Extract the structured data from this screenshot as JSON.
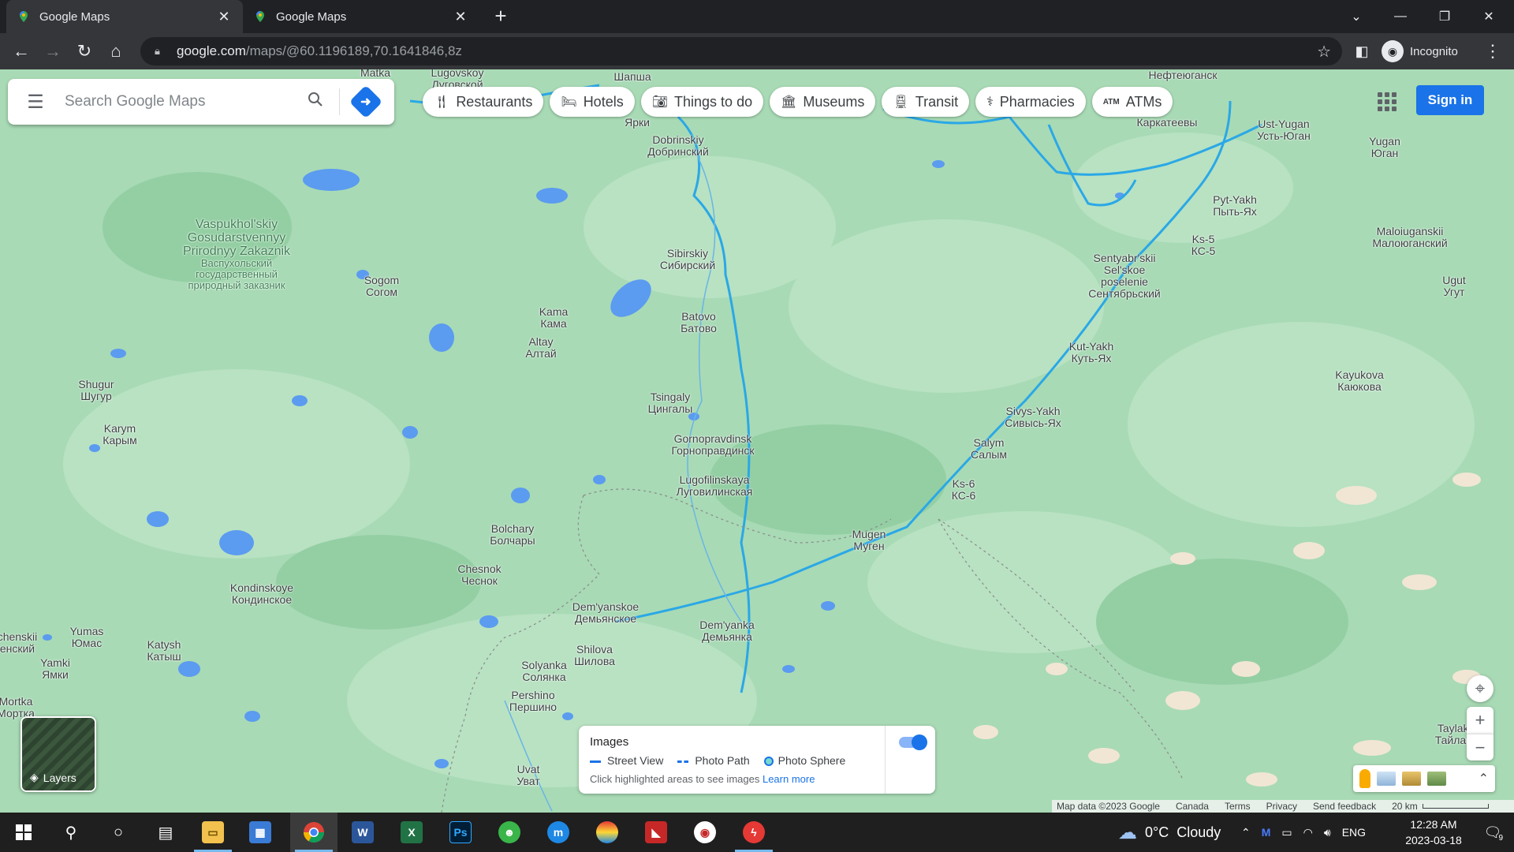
{
  "browser": {
    "tabs": [
      {
        "title": "Google Maps"
      },
      {
        "title": "Google Maps"
      }
    ],
    "url_host": "google.com",
    "url_path": "/maps/@60.1196189,70.1641846,8z",
    "profile_label": "Incognito"
  },
  "maps": {
    "search_placeholder": "Search Google Maps",
    "chips": [
      {
        "label": "Restaurants",
        "icon": "fork-knife-icon"
      },
      {
        "label": "Hotels",
        "icon": "bed-icon"
      },
      {
        "label": "Things to do",
        "icon": "camera-icon"
      },
      {
        "label": "Museums",
        "icon": "museum-icon"
      },
      {
        "label": "Transit",
        "icon": "train-icon"
      },
      {
        "label": "Pharmacies",
        "icon": "pharmacy-icon"
      },
      {
        "label": "ATMs",
        "icon": "atm-icon"
      }
    ],
    "sign_in": "Sign in",
    "layers_label": "Layers",
    "images_panel": {
      "title": "Images",
      "street_view": "Street View",
      "photo_path": "Photo Path",
      "photo_sphere": "Photo Sphere",
      "hint": "Click highlighted areas to see images",
      "learn_more": "Learn more",
      "toggle_on": true
    },
    "attribution": {
      "map_data": "Map data ©2023 Google",
      "country": "Canada",
      "terms": "Terms",
      "privacy": "Privacy",
      "feedback": "Send feedback",
      "scale": "20 km"
    },
    "places": [
      {
        "en": "Matka",
        "ru": ""
      },
      {
        "en": "Lugovskoy",
        "ru": "Луговской"
      },
      {
        "en": "",
        "ru": "Шапша"
      },
      {
        "en": "",
        "ru": "Ярки"
      },
      {
        "en": "Dobrinskiy",
        "ru": "Добринский"
      },
      {
        "en": "Vaspukhol'skiy Gosudarstvennyy Prirodnyy Zakaznik",
        "ru": "Васпухольский государственный природный заказник"
      },
      {
        "en": "Sogom",
        "ru": "Согом"
      },
      {
        "en": "Sibirskiy",
        "ru": "Сибирский"
      },
      {
        "en": "Kama",
        "ru": "Кама"
      },
      {
        "en": "Batovo",
        "ru": "Батово"
      },
      {
        "en": "Altay",
        "ru": "Алтай"
      },
      {
        "en": "Shugur",
        "ru": "Шугур"
      },
      {
        "en": "Tsingaly",
        "ru": "Цингалы"
      },
      {
        "en": "Karym",
        "ru": "Карым"
      },
      {
        "en": "Gornopravdinsk",
        "ru": "Горноправдинск"
      },
      {
        "en": "Lugofilinskaya",
        "ru": "Луговилинская"
      },
      {
        "en": "Bolchary",
        "ru": "Болчары"
      },
      {
        "en": "Mugen",
        "ru": "Муген"
      },
      {
        "en": "Chesnok",
        "ru": "Чеснок"
      },
      {
        "en": "Kondinskoye",
        "ru": "Кондинское"
      },
      {
        "en": "Dem'yanskoe",
        "ru": "Демьянское"
      },
      {
        "en": "Dem'yanka",
        "ru": "Демьянка"
      },
      {
        "en": "Yumas",
        "ru": "Юмас"
      },
      {
        "en": "Katysh",
        "ru": "Катыш"
      },
      {
        "en": "Shilova",
        "ru": "Шилова"
      },
      {
        "en": "Yamki",
        "ru": "Ямки"
      },
      {
        "en": "Solyanka",
        "ru": "Солянка"
      },
      {
        "en": "Pershino",
        "ru": "Першино"
      },
      {
        "en": "Uvat",
        "ru": "Уват"
      },
      {
        "en": "",
        "ru": "Нефтеюганск"
      },
      {
        "en": "",
        "ru": "Каркатеевы"
      },
      {
        "en": "Ust-Yugan",
        "ru": "Усть-Юган"
      },
      {
        "en": "Yugan",
        "ru": "Юган"
      },
      {
        "en": "Pyt-Yakh",
        "ru": "Пыть-Ях"
      },
      {
        "en": "Ks-5",
        "ru": "КС-5"
      },
      {
        "en": "Sentyabr'skii Sel'skoe poselenie",
        "ru": "Сентябрьский"
      },
      {
        "en": "Maloiuganskii",
        "ru": "Малоюганский"
      },
      {
        "en": "Ugut",
        "ru": "Угут"
      },
      {
        "en": "Kut-Yakh",
        "ru": "Куть-Ях"
      },
      {
        "en": "Kayukova",
        "ru": "Каюкова"
      },
      {
        "en": "Sivys-Yakh",
        "ru": "Сивысь-Ях"
      },
      {
        "en": "Salym",
        "ru": "Салым"
      },
      {
        "en": "Ks-6",
        "ru": "КС-6"
      },
      {
        "en": "Taylakovo",
        "ru": "Тайлаково"
      },
      {
        "en": "Mortka",
        "ru": "Мортка"
      },
      {
        "en": "chenskii",
        "ru": "енский"
      }
    ]
  },
  "taskbar": {
    "weather_temp": "0°C",
    "weather_text": "Cloudy",
    "lang": "ENG",
    "time": "12:28 AM",
    "date": "2023-03-18",
    "notification_count": "9"
  },
  "colors": {
    "map_land": "#a8dab5",
    "map_water": "#5b9bf0",
    "road": "#2aa8e6",
    "accent": "#1a73e8"
  }
}
